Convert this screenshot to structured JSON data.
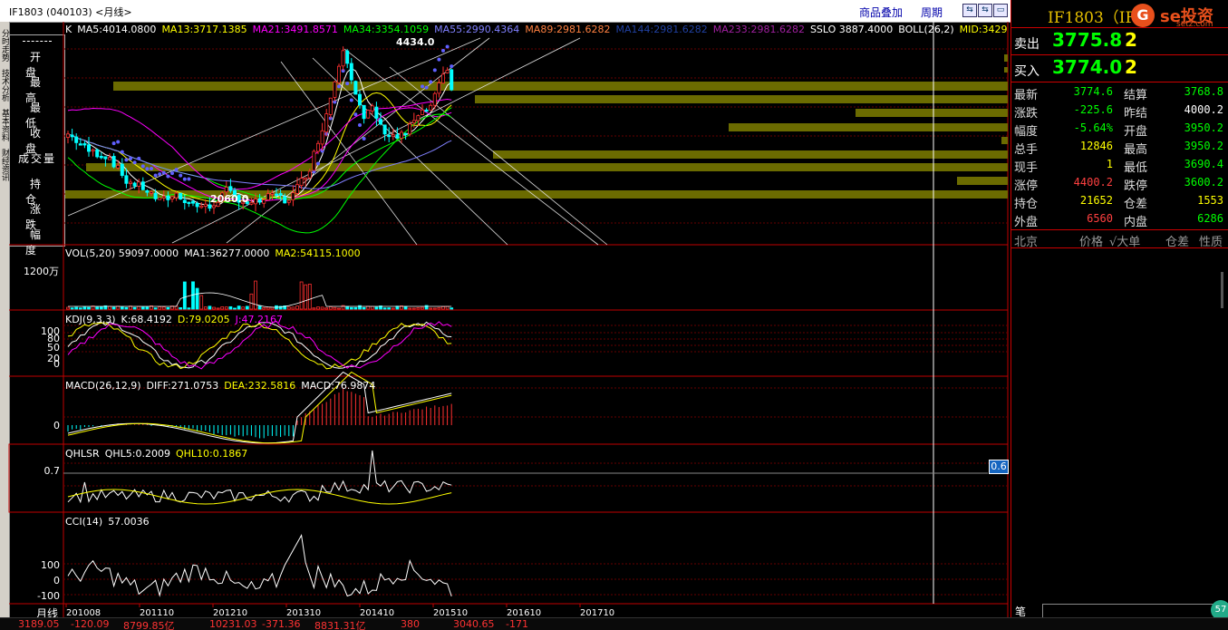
{
  "topbar": {
    "title": "IF1803 (040103) <月线>",
    "overlay_link": "商品叠加",
    "period_link": "周期",
    "btn1": "⇆",
    "btn2": "⇆",
    "btn3": "▭"
  },
  "left_strip": [
    "分时走势",
    "技术分析",
    "基本资料",
    "财经资讯"
  ],
  "field_box": [
    "开 盘",
    "最 高",
    "最 低",
    "收 盘",
    "成交量",
    "持 仓",
    "涨 跌",
    "幅 度"
  ],
  "x_axis_label": "月线",
  "x_ticks": [
    "201008",
    "201110",
    "201210",
    "201310",
    "201410",
    "201510",
    "201610",
    "201710"
  ],
  "main_indicators": [
    {
      "text": "K",
      "color": "#ffffff"
    },
    {
      "text": "MA5:4014.0800",
      "color": "#ffffff"
    },
    {
      "text": "MA13:3717.1385",
      "color": "#ffff00"
    },
    {
      "text": "MA21:3491.8571",
      "color": "#ff00ff"
    },
    {
      "text": "MA34:3354.1059",
      "color": "#00ff00"
    },
    {
      "text": "MA55:2990.4364",
      "color": "#8080ff"
    },
    {
      "text": "MA89:2981.6282",
      "color": "#ff8040"
    },
    {
      "text": "MA144:2981.6282",
      "color": "#2040a0"
    },
    {
      "text": "MA233:2981.6282",
      "color": "#a020a0"
    },
    {
      "text": "SSLO 3887.4000",
      "color": "#ffffff"
    },
    {
      "text": "BOLL(26,2)",
      "color": "#ffffff"
    },
    {
      "text": "MID:3429",
      "color": "#ffff00"
    }
  ],
  "annot_high": "4434.0",
  "annot_low": "2060.0",
  "vol_panel": {
    "header": [
      {
        "text": "VOL(5,20) 59097.0000",
        "color": "#ffffff"
      },
      {
        "text": "MA1:36277.0000",
        "color": "#ffffff"
      },
      {
        "text": "MA2:54115.1000",
        "color": "#ffff00"
      }
    ],
    "ylabel": "1200万"
  },
  "kdj_panel": {
    "header": [
      {
        "text": "KDJ(9,3,3)",
        "color": "#ffffff"
      },
      {
        "text": "K:68.4192",
        "color": "#ffffff"
      },
      {
        "text": "D:79.0205",
        "color": "#ffff00"
      },
      {
        "text": "J:47.2167",
        "color": "#ff00ff"
      }
    ],
    "yticks": [
      "100",
      "80",
      "50",
      "20",
      "0"
    ]
  },
  "macd_panel": {
    "header": [
      {
        "text": "MACD(26,12,9)",
        "color": "#ffffff"
      },
      {
        "text": "DIFF:271.0753",
        "color": "#ffffff"
      },
      {
        "text": "DEA:232.5816",
        "color": "#ffff00"
      },
      {
        "text": "MACD:76.9874",
        "color": "#ffffff"
      }
    ],
    "ytick": "0"
  },
  "qhlsr_panel": {
    "header": [
      {
        "text": "QHLSR",
        "color": "#ffffff"
      },
      {
        "text": "QHL5:0.2009",
        "color": "#ffffff"
      },
      {
        "text": "QHL10:0.1867",
        "color": "#ffff00"
      }
    ],
    "ytick": "0.7",
    "cursor_value": "0.6"
  },
  "cci_panel": {
    "header": [
      {
        "text": "CCI(14)",
        "color": "#ffffff"
      },
      {
        "text": "57.0036",
        "color": "#ffffff"
      }
    ],
    "yticks": [
      "100",
      "0",
      "-100"
    ]
  },
  "chart_data": {
    "type": "candlestick",
    "x": [
      "201008",
      "201110",
      "201210",
      "201310",
      "201410",
      "201510",
      "201610",
      "201710"
    ],
    "high_annotation": 4434.0,
    "low_annotation": 2060.0,
    "last_close": 3774.6,
    "ma": {
      "MA5": 4014.08,
      "MA13": 3717.1385,
      "MA21": 3491.8571,
      "MA34": 3354.1059,
      "MA55": 2990.4364
    },
    "indicators": {
      "VOL": 59097,
      "KDJ_K": 68.4192,
      "KDJ_D": 79.0205,
      "KDJ_J": 47.2167,
      "DIFF": 271.0753,
      "DEA": 232.5816,
      "MACD": 76.9874,
      "QHL5": 0.2009,
      "QHL10": 0.1867,
      "CCI": 57.0036
    }
  },
  "right_panel": {
    "title": "IF1803（IF）",
    "logo_text": "se投资",
    "logo_sub": "setz.com",
    "ask": {
      "label": "卖出",
      "price": "3775.8",
      "vol": "2"
    },
    "bid": {
      "label": "买入",
      "price": "3774.0",
      "vol": "2"
    },
    "quotes": [
      {
        "l1": "最新",
        "v1": "3774.6",
        "c1": "#00ff00",
        "l2": "结算",
        "v2": "3768.8",
        "c2": "#00ff00"
      },
      {
        "l1": "涨跌",
        "v1": "-225.6",
        "c1": "#00ff00",
        "l2": "昨结",
        "v2": "4000.2",
        "c2": "#ffffff"
      },
      {
        "l1": "幅度",
        "v1": "-5.64%",
        "c1": "#00ff00",
        "l2": "开盘",
        "v2": "3950.2",
        "c2": "#00ff00"
      },
      {
        "l1": "总手",
        "v1": "12846",
        "c1": "#ffff00",
        "l2": "最高",
        "v2": "3950.2",
        "c2": "#00ff00"
      },
      {
        "l1": "现手",
        "v1": "1",
        "c1": "#ffff00",
        "l2": "最低",
        "v2": "3690.4",
        "c2": "#00ff00"
      },
      {
        "l1": "涨停",
        "v1": "4400.2",
        "c1": "#ff4040",
        "l2": "跌停",
        "v2": "3600.2",
        "c2": "#00ff00"
      },
      {
        "l1": "持仓",
        "v1": "21652",
        "c1": "#ffff00",
        "l2": "仓差",
        "v2": "1553",
        "c2": "#ffff00"
      },
      {
        "l1": "外盘",
        "v1": "6560",
        "c1": "#ff4040",
        "l2": "内盘",
        "v2": "6286",
        "c2": "#00ff00"
      }
    ],
    "tick_header": {
      "loc": "北京",
      "price": "价格",
      "vol": "√大单",
      "oi": "仓差",
      "nature": "性质"
    },
    "bottom_tab": "笔",
    "knob": "57"
  },
  "bottom_bar": [
    "3189.05",
    "-120.09",
    "8799.85亿",
    "10231.03",
    "-371.36",
    "8831.31亿",
    "380",
    "3040.65",
    "-171"
  ],
  "colors": {
    "up": "#ff3030",
    "down": "#00ffff",
    "panel_border": "#c00000",
    "volume_band": "#6b6b00"
  }
}
